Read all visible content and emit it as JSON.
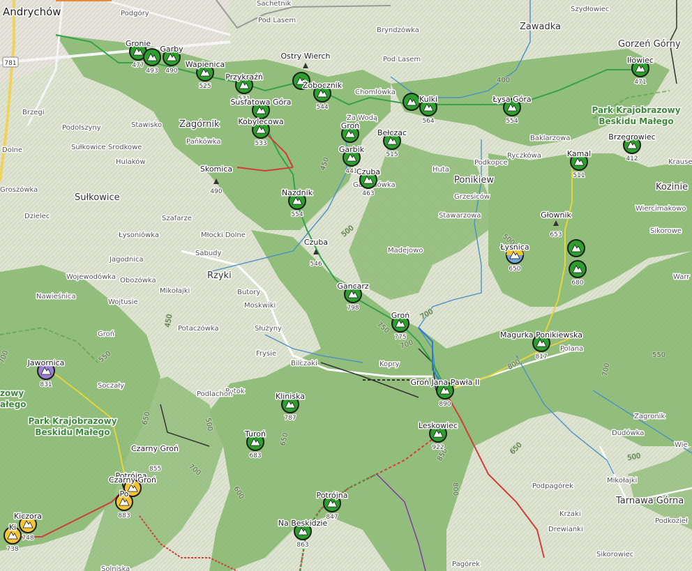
{
  "colors": {
    "forest": "#8fbc78",
    "open": "#dfe4d2",
    "urban": "#e7e2dc",
    "trail_green": "#36a14a",
    "trail_red": "#d23d3d",
    "trail_blue": "#2a7bd0",
    "trail_yellow": "#e5d43b",
    "stream": "#4a90c8",
    "marker_green": "#2ca02c",
    "marker_yellow": "#f2c534",
    "marker_purple": "#9a7fd3",
    "marker_blue_yellow": "#6fa6d6"
  },
  "towns": [
    {
      "label": "Andrychów"
    },
    {
      "label": "Sułkowice"
    },
    {
      "label": "Zagórnik"
    },
    {
      "label": "Rzyki"
    },
    {
      "label": "Ponikiew"
    },
    {
      "label": "Zawadka"
    },
    {
      "label": "Gorzeń Górny"
    },
    {
      "label": "Tarnawa Górna"
    },
    {
      "label": "Kozinie"
    }
  ],
  "hamlets": [
    {
      "label": "Podgóry"
    },
    {
      "label": "Sachetnik"
    },
    {
      "label": "Pod Lasem"
    },
    {
      "label": "Bryndzówka"
    },
    {
      "label": "Pod Lasem"
    },
    {
      "label": "Szydłowiec"
    },
    {
      "label": "Chomlówka"
    },
    {
      "label": "Za Wodą"
    },
    {
      "label": "Stawisko"
    },
    {
      "label": "Pańkówka"
    },
    {
      "label": "Podolszyny"
    },
    {
      "label": "Brzegi"
    },
    {
      "label": "Sułkowice Środkowe"
    },
    {
      "label": "Hulaków"
    },
    {
      "label": "Dolne"
    },
    {
      "label": "Groszówka"
    },
    {
      "label": "Dzielec"
    },
    {
      "label": "Łysoniówka"
    },
    {
      "label": "Szafarze"
    },
    {
      "label": "Młocki Dolne"
    },
    {
      "label": "Sabudy"
    },
    {
      "label": "Jagodnica"
    },
    {
      "label": "Wojewodówka"
    },
    {
      "label": "Obozówka"
    },
    {
      "label": "Mikołajki"
    },
    {
      "label": "Nawieśnica"
    },
    {
      "label": "Wojtusie"
    },
    {
      "label": "Groń"
    },
    {
      "label": "Butory"
    },
    {
      "label": "Moskwiki"
    },
    {
      "label": "Służyny"
    },
    {
      "label": "Potaczówka"
    },
    {
      "label": "Frysie"
    },
    {
      "label": "Potok"
    },
    {
      "label": "Bilczaki"
    },
    {
      "label": "Kopry"
    },
    {
      "label": "Podlachoń"
    },
    {
      "label": "Soczały"
    },
    {
      "label": "Huta"
    },
    {
      "label": "Gawędówka"
    },
    {
      "label": "Grzesiców"
    },
    {
      "label": "Stawarzowa"
    },
    {
      "label": "Madejowo"
    },
    {
      "label": "Podkopce"
    },
    {
      "label": "Ryczkówa"
    },
    {
      "label": "Baklarzowa"
    },
    {
      "label": "Krause"
    },
    {
      "label": "Wiercimakowo"
    },
    {
      "label": "Sikorowe"
    },
    {
      "label": "Warr"
    },
    {
      "label": "Polana"
    },
    {
      "label": "Zagronik"
    },
    {
      "label": "Dudówka"
    },
    {
      "label": "Wie"
    },
    {
      "label": "Mikołajki"
    },
    {
      "label": "Podpagórek"
    },
    {
      "label": "Krzaki"
    },
    {
      "label": "Drewianki"
    },
    {
      "label": "Podkozieł"
    },
    {
      "label": "Sikorowiec"
    },
    {
      "label": "Pagórek"
    },
    {
      "label": "Solniska"
    }
  ],
  "parks": [
    {
      "line1": "Park Krajobrazowy",
      "line2": "Beskidu Małego"
    },
    {
      "line1": "Park Krajobrazowy",
      "line2": "Beskidu Małego"
    },
    {
      "line1": "zowy",
      "line2": "ałego"
    }
  ],
  "peaks": [
    {
      "name": "Ostry Wierch",
      "elev": ""
    },
    {
      "name": "Skomica",
      "elev": "490"
    },
    {
      "name": "Czuba",
      "elev": "546"
    },
    {
      "name": "Głownik",
      "elev": "653"
    }
  ],
  "markers": [
    {
      "name": "Gronie",
      "elev": "477",
      "kind": "green"
    },
    {
      "name": "",
      "elev": "493",
      "kind": "green"
    },
    {
      "name": "Garby",
      "elev": "490",
      "kind": "green"
    },
    {
      "name": "Wapienica",
      "elev": "525",
      "kind": "green"
    },
    {
      "name": "Przykraźń",
      "elev": "531",
      "kind": "green"
    },
    {
      "name": "",
      "elev": "",
      "kind": "green"
    },
    {
      "name": "Żobocznik",
      "elev": "544",
      "kind": "green"
    },
    {
      "name": "Susfatowa Góra",
      "elev": "",
      "kind": "green"
    },
    {
      "name": "Kobylecowa",
      "elev": "533",
      "kind": "green"
    },
    {
      "name": "Groń",
      "elev": "",
      "kind": "green"
    },
    {
      "name": "Garbik",
      "elev": "441",
      "kind": "green"
    },
    {
      "name": "Czuba",
      "elev": "463",
      "kind": "green"
    },
    {
      "name": "Bełczac",
      "elev": "515",
      "kind": "green"
    },
    {
      "name": "",
      "elev": "",
      "kind": "green"
    },
    {
      "name": "Kulki",
      "elev": "564",
      "kind": "green"
    },
    {
      "name": "Łysa Góra",
      "elev": "554",
      "kind": "green"
    },
    {
      "name": "Iłowiec",
      "elev": "471",
      "kind": "green"
    },
    {
      "name": "Brzegrowiec",
      "elev": "412",
      "kind": "green"
    },
    {
      "name": "Kamal",
      "elev": "511",
      "kind": "green"
    },
    {
      "name": "Nazdnik",
      "elev": "554",
      "kind": "green"
    },
    {
      "name": "Gancarz",
      "elev": "798",
      "kind": "green"
    },
    {
      "name": "Groń",
      "elev": "775",
      "kind": "green"
    },
    {
      "name": "",
      "elev": "",
      "kind": "green"
    },
    {
      "name": "",
      "elev": "680",
      "kind": "green"
    },
    {
      "name": "Magurka Ponikiewska",
      "elev": "817",
      "kind": "green"
    },
    {
      "name": "Groń Jana Pawła II",
      "elev": "890",
      "kind": "green"
    },
    {
      "name": "Leskowiec",
      "elev": "922",
      "kind": "green"
    },
    {
      "name": "Kliniska",
      "elev": "787",
      "kind": "green"
    },
    {
      "name": "Turoń",
      "elev": "683",
      "kind": "green"
    },
    {
      "name": "Potrójna",
      "elev": "847",
      "kind": "green"
    },
    {
      "name": "Na Beskidzie",
      "elev": "863",
      "kind": "green"
    },
    {
      "name": "Jawornica",
      "elev": "831",
      "kind": "purple"
    },
    {
      "name": "Łysnica",
      "elev": "650",
      "kind": "blue"
    },
    {
      "name": "Potrójna",
      "elev": "",
      "kind": "yellow"
    },
    {
      "name": "Czarny Groń",
      "elev": "",
      "kind": "yellow"
    },
    {
      "name": "Po",
      "elev": "883",
      "kind": "yellow"
    },
    {
      "name": "Kiczora",
      "elev": "748",
      "kind": "yellow"
    },
    {
      "name": "Ki",
      "elev": "738",
      "kind": "yellow"
    }
  ],
  "contour_labels": [
    "400",
    "450",
    "500",
    "500",
    "500",
    "550",
    "650",
    "700",
    "700",
    "700",
    "750",
    "800",
    "850",
    "800",
    "650",
    "700",
    "600",
    "650",
    "500",
    "450",
    "700",
    "550",
    "500",
    "500",
    "550",
    "600",
    "650",
    "700",
    "750",
    "800",
    "850"
  ],
  "road_badges": [
    "781"
  ],
  "extra_labels": {
    "czarny_gron": "Czarny Groń",
    "cz_855": "855"
  }
}
